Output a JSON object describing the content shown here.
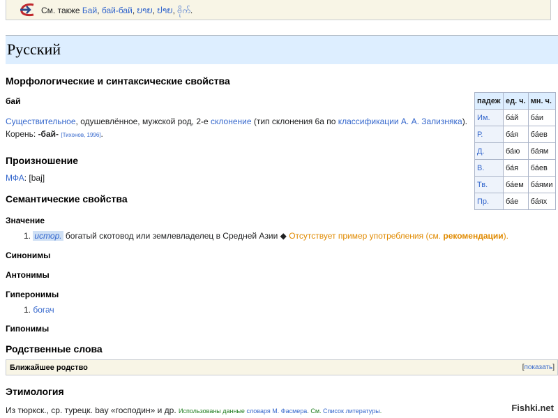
{
  "see_also": {
    "prefix": "См. также",
    "links": [
      "Бай",
      "бай-бай",
      "ບາຍ",
      "ປາຍ",
      "ဗိုက်"
    ]
  },
  "language_heading": "Русский",
  "morph": {
    "heading": "Морфологические и синтаксические свойства",
    "lemma": "бай",
    "pos": "Существительное",
    "desc1": ", одушевлённое, мужской род, 2-е ",
    "declension_link": "склонение",
    "desc2": " (тип склонения 6a по ",
    "classification_link": "классификации А. А. Зализняка",
    "desc3": ").",
    "root_label": "Корень: ",
    "root": "-бай-",
    "root_ref": "[Тихонов, 1996]",
    "root_end": "."
  },
  "declension_table": {
    "headers": [
      "падеж",
      "ед. ч.",
      "мн. ч."
    ],
    "rows": [
      [
        "Им.",
        "ба́й",
        "ба́и"
      ],
      [
        "Р.",
        "ба́я",
        "ба́ев"
      ],
      [
        "Д.",
        "ба́ю",
        "ба́ям"
      ],
      [
        "В.",
        "ба́я",
        "ба́ев"
      ],
      [
        "Тв.",
        "ба́ем",
        "ба́ями"
      ],
      [
        "Пр.",
        "ба́е",
        "ба́ях"
      ]
    ]
  },
  "pronunciation": {
    "heading": "Произношение",
    "ipa_label": "МФА",
    "ipa": ": [baj]"
  },
  "semantic": {
    "heading": "Семантические свойства",
    "meaning_heading": "Значение",
    "meaning_num": "1.",
    "meaning_tag": "истор.",
    "meaning_text": " богатый скотовод или землевладелец в Средней Азии ◆ ",
    "no_example": "Отсутствует пример употребления (см. ",
    "recommend": "рекомендации",
    "no_example_end": ").",
    "synonyms": "Синонимы",
    "antonyms": "Антонимы",
    "hypernyms": "Гиперонимы",
    "hypernym_num": "1.",
    "hypernym_item": "богач",
    "hyponyms": "Гипонимы"
  },
  "related": {
    "heading": "Родственные слова",
    "kin_label": "Ближайшее родство",
    "show_open": "[",
    "show": "показать",
    "show_close": "]"
  },
  "etymology": {
    "heading": "Этимология",
    "text": "Из тюркск., ср. турецк. bay «господин» и др. ",
    "used": "Использованы данные ",
    "dict": "словаря М. Фасмера",
    "see": ". См. ",
    "lit": "Список литературы",
    "end": "."
  },
  "watermark": "Fishki.net"
}
